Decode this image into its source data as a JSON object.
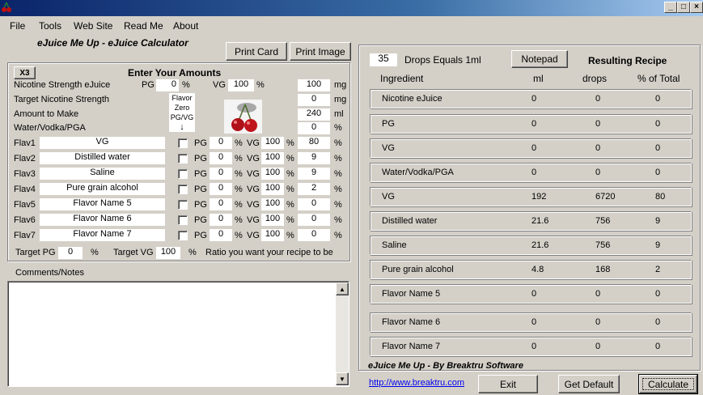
{
  "menu": {
    "file": "File",
    "tools": "Tools",
    "website": "Web Site",
    "readme": "Read Me",
    "about": "About"
  },
  "app_title": "eJuice Me Up - eJuice Calculator",
  "buttons": {
    "print_card": "Print Card",
    "print_image": "Print Image",
    "x3": "X3",
    "notepad": "Notepad",
    "exit": "Exit",
    "get_default": "Get Default",
    "calculate": "Calculate"
  },
  "enter_amounts": "Enter Your Amounts",
  "nicotine": {
    "label": "Nicotine Strength eJuice",
    "pg_label": "PG",
    "pg": "0",
    "vg_label": "VG",
    "vg": "100",
    "pct": "%",
    "value": "100",
    "unit": "mg"
  },
  "target_nicotine": {
    "label": "Target Nicotine Strength",
    "value": "0",
    "unit": "mg"
  },
  "amount": {
    "label": "Amount to Make",
    "value": "240",
    "unit": "ml"
  },
  "water": {
    "label": "Water/Vodka/PGA",
    "value": "0",
    "unit": "%"
  },
  "flavor_zero": {
    "line1": "Flavor",
    "line2": "Zero",
    "line3": "PG/VG",
    "arrow": "↓"
  },
  "flavors": [
    {
      "label": "Flav1",
      "name": "VG",
      "pg": "0",
      "vg": "100",
      "pct": "80"
    },
    {
      "label": "Flav2",
      "name": "Distilled water",
      "pg": "0",
      "vg": "100",
      "pct": "9"
    },
    {
      "label": "Flav3",
      "name": "Saline",
      "pg": "0",
      "vg": "100",
      "pct": "9"
    },
    {
      "label": "Flav4",
      "name": "Pure grain alcohol",
      "pg": "0",
      "vg": "100",
      "pct": "2"
    },
    {
      "label": "Flav5",
      "name": "Flavor Name 5",
      "pg": "0",
      "vg": "100",
      "pct": "0"
    },
    {
      "label": "Flav6",
      "name": "Flavor Name 6",
      "pg": "0",
      "vg": "100",
      "pct": "0"
    },
    {
      "label": "Flav7",
      "name": "Flavor Name 7",
      "pg": "0",
      "vg": "100",
      "pct": "0"
    }
  ],
  "flav_pg_label": "PG",
  "flav_vg_label": "VG",
  "percent": "%",
  "target": {
    "pg_label": "Target PG",
    "pg": "0",
    "vg_label": "Target VG",
    "vg": "100",
    "ratio_text": "Ratio you want your recipe to be"
  },
  "comments_label": "Comments/Notes",
  "drops": {
    "value": "35",
    "label": "Drops Equals 1ml"
  },
  "resulting_recipe": "Resulting Recipe",
  "result_headers": {
    "ingredient": "Ingredient",
    "ml": "ml",
    "drops": "drops",
    "pct_total": "% of Total"
  },
  "results": [
    {
      "name": "Nicotine eJuice",
      "ml": "0",
      "drops": "0",
      "pct": "0"
    },
    {
      "name": "PG",
      "ml": "0",
      "drops": "0",
      "pct": "0"
    },
    {
      "name": "VG",
      "ml": "0",
      "drops": "0",
      "pct": "0"
    },
    {
      "name": "Water/Vodka/PGA",
      "ml": "0",
      "drops": "0",
      "pct": "0"
    },
    {
      "name": "VG",
      "ml": "192",
      "drops": "6720",
      "pct": "80"
    },
    {
      "name": "Distilled water",
      "ml": "21.6",
      "drops": "756",
      "pct": "9"
    },
    {
      "name": "Saline",
      "ml": "21.6",
      "drops": "756",
      "pct": "9"
    },
    {
      "name": "Pure grain alcohol",
      "ml": "4.8",
      "drops": "168",
      "pct": "2"
    },
    {
      "name": "Flavor Name 5",
      "ml": "0",
      "drops": "0",
      "pct": "0"
    },
    {
      "name": "Flavor Name 6",
      "ml": "0",
      "drops": "0",
      "pct": "0"
    },
    {
      "name": "Flavor Name 7",
      "ml": "0",
      "drops": "0",
      "pct": "0"
    }
  ],
  "credit": "eJuice Me Up -  By Breaktru Software",
  "website_link": "http://www.breaktru.com",
  "window_controls": {
    "minimize": "_",
    "maximize": "□",
    "close": "×"
  },
  "colors": {
    "title_start": "#0a246a",
    "title_end": "#a6caf0",
    "link": "#0000ee",
    "face": "#d4d0c8"
  }
}
